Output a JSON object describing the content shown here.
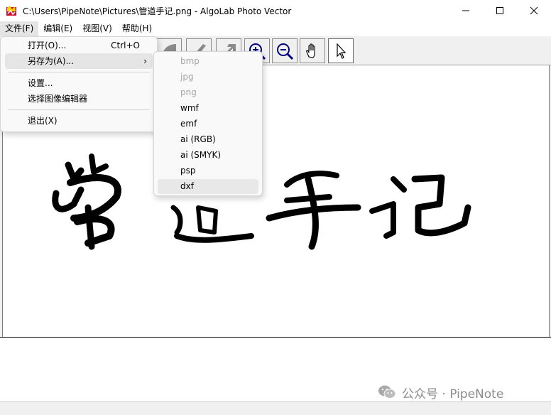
{
  "window": {
    "title": "C:\\Users\\PipeNote\\Pictures\\管道手记.png - AlgoLab Photo Vector"
  },
  "menubar": {
    "items": [
      {
        "label": "文件(F)"
      },
      {
        "label": "编辑(E)"
      },
      {
        "label": "视图(V)"
      },
      {
        "label": "帮助(H)"
      }
    ]
  },
  "file_menu": {
    "open": {
      "label": "打开(O)...",
      "shortcut": "Ctrl+O"
    },
    "save_as": {
      "label": "另存为(A)...",
      "arrow": "›"
    },
    "settings": {
      "label": "设置..."
    },
    "choose_editor": {
      "label": "选择图像编辑器"
    },
    "exit": {
      "label": "退出(X)"
    }
  },
  "save_as_submenu": {
    "items": [
      {
        "label": "bmp",
        "enabled": false
      },
      {
        "label": "jpg",
        "enabled": false
      },
      {
        "label": "png",
        "enabled": false
      },
      {
        "label": "wmf",
        "enabled": true
      },
      {
        "label": "emf",
        "enabled": true
      },
      {
        "label": "ai (RGB)",
        "enabled": true
      },
      {
        "label": "ai (SMYK)",
        "enabled": true
      },
      {
        "label": "psp",
        "enabled": true
      },
      {
        "label": "dxf",
        "enabled": true
      }
    ]
  },
  "toolbar": {
    "icons": [
      "rotate-icon",
      "apply-icon",
      "export-icon",
      "zoom-in-icon",
      "zoom-out-icon",
      "hand-icon",
      "pointer-icon"
    ]
  },
  "watermark": {
    "text": "公众号 · PipeNote"
  },
  "colors": {
    "menu_bg": "#f9f9f9",
    "highlight": "#e5e5e5",
    "disabled_text": "#a5a5a5"
  }
}
